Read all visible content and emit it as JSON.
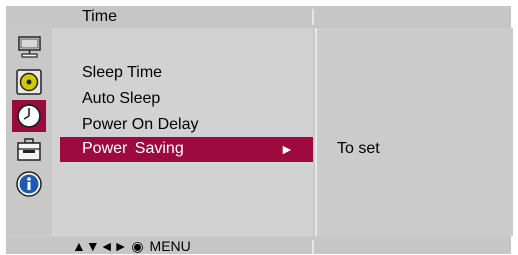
{
  "header": {
    "title": "Time"
  },
  "sidebar": {
    "icons": [
      "monitor-icon",
      "disc-icon",
      "clock-icon",
      "toolbox-icon",
      "info-icon"
    ],
    "active": "clock-icon",
    "active_color": "#9a0a3c"
  },
  "menu": {
    "items": [
      {
        "label": "Sleep Time"
      },
      {
        "label": "Auto Sleep"
      },
      {
        "label": "Power On Delay"
      },
      {
        "label": "Power  Saving",
        "selected": true,
        "arrow": "►"
      }
    ],
    "selected_color": "#9c0a3e"
  },
  "detail": {
    "text": "To set"
  },
  "footer": {
    "nav_glyphs": "▲▼◄► ◉",
    "menu_label": "MENU"
  }
}
